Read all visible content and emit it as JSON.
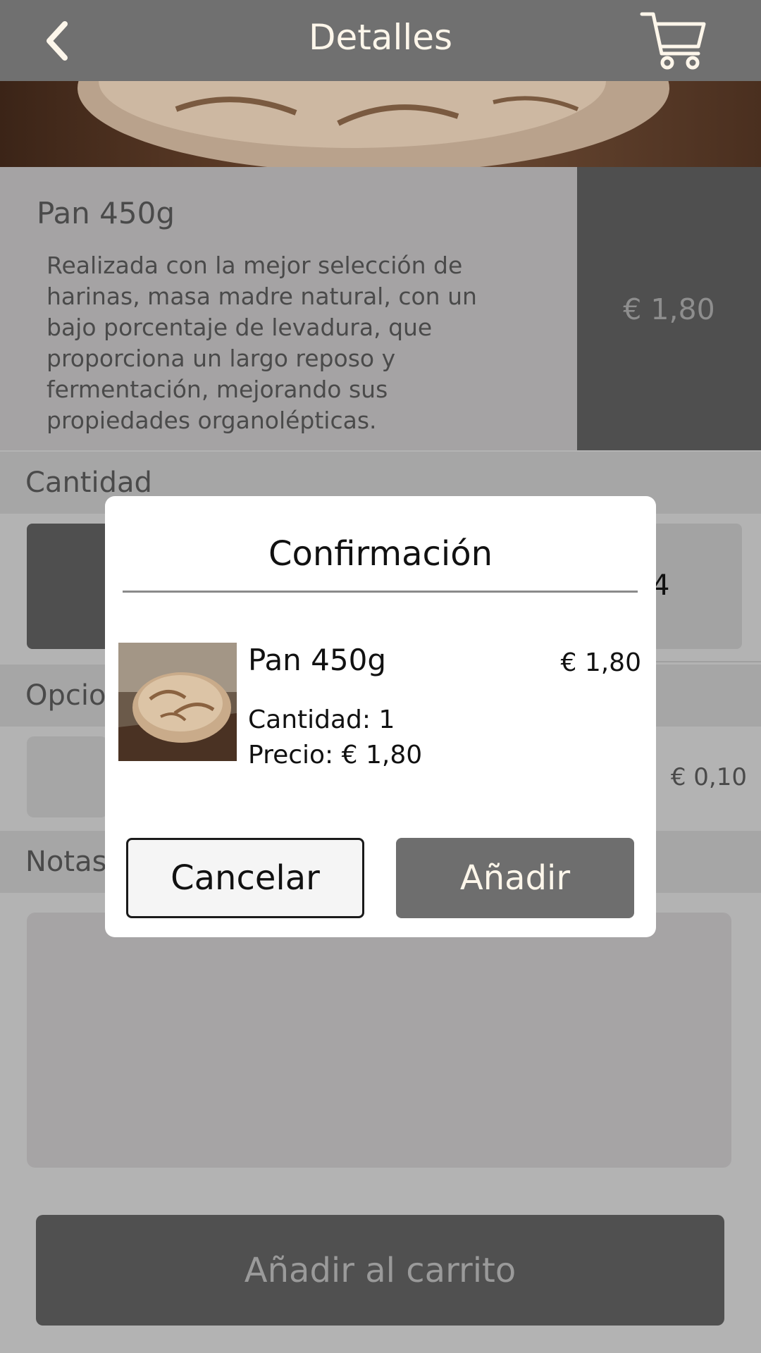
{
  "header": {
    "title": "Detalles",
    "back_icon": "chevron-left-icon",
    "cart_icon": "shopping-cart-icon"
  },
  "product": {
    "name": "Pan 450g",
    "description": "Realizada con la mejor selección de harinas, masa madre natural, con un bajo porcentaje de levadura, que proporciona un largo reposo y fermentación, mejorando sus propiedades organolépticas.",
    "price": "€ 1,80"
  },
  "sections": {
    "quantity_label": "Cantidad",
    "quantity_value": "4",
    "options_label": "Opcio",
    "option_price": "€ 0,10",
    "notes_label": "Notas"
  },
  "add_to_cart_label": "Añadir al carrito",
  "dialog": {
    "title": "Confirmación",
    "item_name": "Pan 450g",
    "item_price": "€ 1,80",
    "quantity_line": "Cantidad: 1",
    "price_line": "Precio: € 1,80",
    "cancel_label": "Cancelar",
    "add_label": "Añadir"
  },
  "colors": {
    "topbar": "#707070",
    "header_text": "#fdf6ea",
    "primary_button": "#6e6e6e",
    "overlay_bg": "#b3b3b3"
  }
}
